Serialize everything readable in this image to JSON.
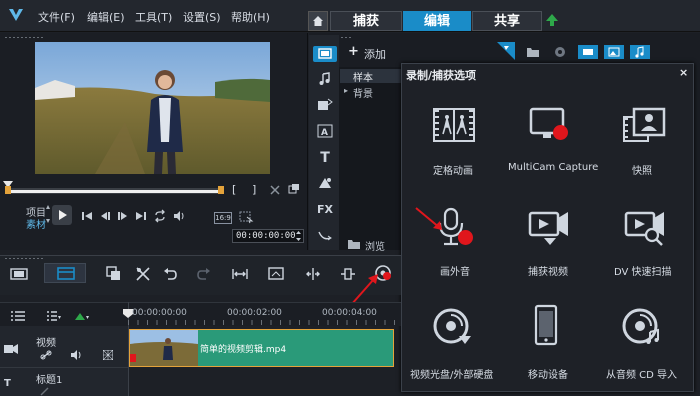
{
  "menu": {
    "items": [
      "文件(F)",
      "编辑(E)",
      "工具(T)",
      "设置(S)",
      "帮助(H)"
    ]
  },
  "tabs": [
    {
      "label": "捕获",
      "active": false
    },
    {
      "label": "编辑",
      "active": true
    },
    {
      "label": "共享",
      "active": false
    }
  ],
  "preview": {
    "mode_project": "项目",
    "mode_clip": "素材",
    "aspect_ratio": "16:9",
    "timecode": "00:00:00:00"
  },
  "library": {
    "add_label": "添加",
    "tree": [
      {
        "label": "样本",
        "selected": true
      },
      {
        "label": "背景",
        "selected": false
      }
    ],
    "browse_label": "浏览",
    "side_icons": [
      "video-library-icon",
      "audio-icon",
      "transition-icon",
      "title-icon",
      "text-icon",
      "graphics-icon",
      "fx-icon",
      "path-icon"
    ],
    "fx_label": "FX",
    "title_glyph": "T"
  },
  "popup": {
    "title": "录制/捕获选项",
    "close": "×",
    "options": [
      {
        "label": "定格动画",
        "icon": "stop-motion-icon"
      },
      {
        "label": "MultiCam Capture",
        "icon": "multicam-icon"
      },
      {
        "label": "快照",
        "icon": "snapshot-icon"
      },
      {
        "label": "画外音",
        "icon": "microphone-icon"
      },
      {
        "label": "捕获视频",
        "icon": "capture-video-icon"
      },
      {
        "label": "DV 快速扫描",
        "icon": "dv-scan-icon"
      },
      {
        "label": "视频光盘/外部硬盘",
        "icon": "disc-icon"
      },
      {
        "label": "移动设备",
        "icon": "mobile-device-icon"
      },
      {
        "label": "从音频 CD 导入",
        "icon": "audio-cd-icon"
      }
    ]
  },
  "timeline": {
    "ruler": [
      "00:00:00:00",
      "00:00:02:00",
      "00:00:04:00"
    ],
    "tracks": [
      {
        "label": "视频"
      },
      {
        "label": "标题1"
      }
    ],
    "clip_label": "简单的视频剪辑.mp4"
  },
  "colors": {
    "accent": "#1a8cc8",
    "clip": "#2a9a79",
    "record_dot": "#e0161c",
    "annotation_arrow": "#e0161c"
  }
}
